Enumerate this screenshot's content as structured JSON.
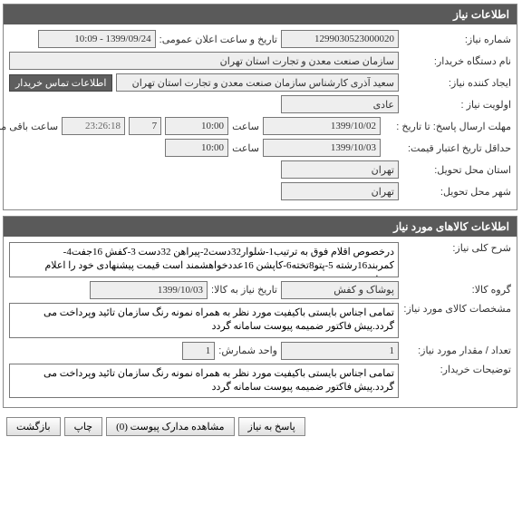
{
  "sections": {
    "need_info": {
      "title": "اطلاعات نیاز",
      "need_number_label": "شماره نیاز:",
      "need_number": "1299030523000020",
      "announce_label": "تاریخ و ساعت اعلان عمومی:",
      "announce_value": "1399/09/24 - 10:09",
      "org_label": "نام دستگاه خریدار:",
      "org_value": "سازمان صنعت معدن و تجارت استان تهران",
      "creator_label": "ایجاد کننده نیاز:",
      "creator_value": "سعید آذری کارشناس سازمان صنعت معدن و تجارت استان تهران",
      "contact_btn": "اطلاعات تماس خریدار",
      "priority_label": "اولویت نیاز :",
      "priority_value": "عادی",
      "deadline_label": "مهلت ارسال پاسخ:  تا تاریخ :",
      "deadline_date": "1399/10/02",
      "time_label": "ساعت",
      "deadline_time": "10:00",
      "remaining_days": "7",
      "remaining_time": "23:26:18",
      "remaining_text": "ساعت باقی مانده",
      "min_validity_label": "حداقل تاریخ اعتبار قیمت:",
      "min_validity_date": "1399/10/03",
      "min_validity_time": "10:00",
      "delivery_province_label": "استان محل تحویل:",
      "delivery_province": "تهران",
      "delivery_city_label": "شهر محل تحویل:",
      "delivery_city": "تهران"
    },
    "goods_info": {
      "title": "اطلاعات کالاهای مورد نیاز",
      "main_desc_label": "شرح کلی نیاز:",
      "main_desc": "درخصوص اقلام فوق به ترتیب1-شلوار32دست2-پیراهن 32دست 3-کفش 16جفت4-کمربند16رشته 5-پتو8تخته6-کاپشن 16عددخواهشمند است قیمت پیشنهادی خود را اعلام فرمائید",
      "group_label": "گروه کالا:",
      "group_value": "پوشاک و کفش",
      "need_date_label": "تاریخ نیاز به کالا:",
      "need_date": "1399/10/03",
      "spec_label": "مشخصات کالای مورد نیاز:",
      "spec_text": "تمامی اجناس بایستی باکیفیت مورد نظر به همراه نمونه رنگ سازمان تائید وپرداخت می گردد.پیش فاکتور ضمیمه پیوست سامانه گردد",
      "qty_label": "تعداد / مقدار مورد نیاز:",
      "qty_value": "1",
      "unit_label": "واحد شمارش:",
      "unit_value": "1",
      "buyer_notes_label": "توضیحات خریدار:",
      "buyer_notes": "تمامی اجناس بایستی باکیفیت مورد نظر به همراه نمونه رنگ سازمان تائید وپرداخت می گردد.پیش فاکتور ضمیمه پیوست سامانه گردد"
    }
  },
  "buttons": {
    "reply": "پاسخ به نیاز",
    "view_docs": "مشاهده مدارک پیوست (0)",
    "print": "چاپ",
    "back": "بازگشت"
  }
}
